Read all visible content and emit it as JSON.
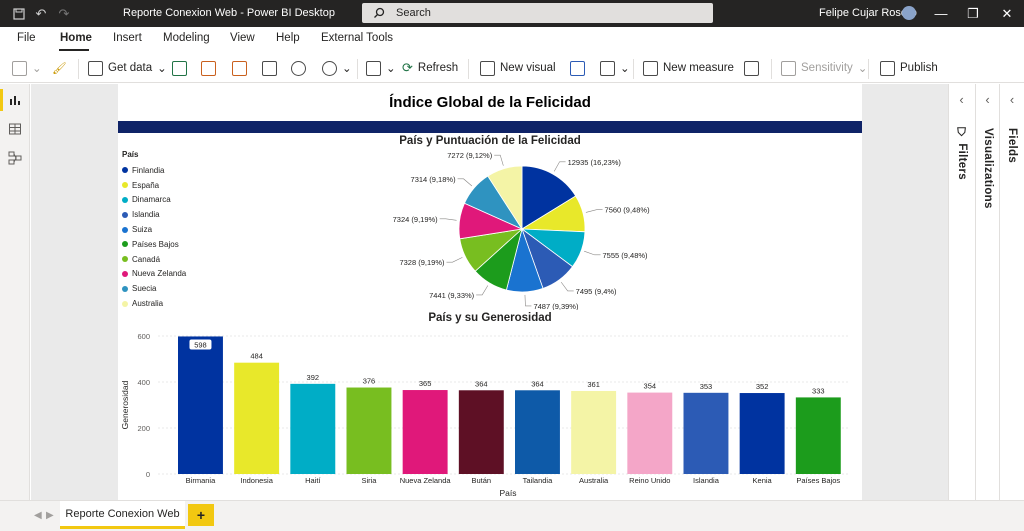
{
  "window": {
    "title": "Reporte Conexion Web - Power BI Desktop",
    "search_placeholder": "Search",
    "user": "Felipe Cujar Rosero"
  },
  "menu": [
    "File",
    "Home",
    "Insert",
    "Modeling",
    "View",
    "Help",
    "External Tools"
  ],
  "ribbon": {
    "get_data": "Get data",
    "refresh": "Refresh",
    "new_visual": "New visual",
    "new_measure": "New measure",
    "sensitivity": "Sensitivity",
    "publish": "Publish"
  },
  "report": {
    "title": "Índice Global de la Felicidad"
  },
  "panes": {
    "filters": "Filters",
    "visualizations": "Visualizations",
    "fields": "Fields"
  },
  "tabs": {
    "page": "Reporte Conexion Web",
    "add": "+"
  },
  "chart_data": [
    {
      "type": "pie",
      "title": "País y Puntuación de la Felicidad",
      "legend_title": "País",
      "legend_position": "left",
      "categories": [
        "Finlandia",
        "España",
        "Dinamarca",
        "Islandia",
        "Suiza",
        "Países Bajos",
        "Canadá",
        "Nueva Zelanda",
        "Suecia",
        "Australia"
      ],
      "values": [
        12935,
        7560,
        7555,
        7495,
        7487,
        7441,
        7328,
        7324,
        7314,
        7272
      ],
      "labels": [
        "12935 (16,23%)",
        "7560 (9,48%)",
        "7555 (9,48%)",
        "7495 (9,4%)",
        "7487 (9,39%)",
        "7441 (9,33%)",
        "7328 (9,19%)",
        "7324 (9,19%)",
        "7314 (9,18%)",
        "7272 (9,12%)"
      ],
      "colors": [
        "#0033a0",
        "#e8e82a",
        "#00adc6",
        "#2c5bb5",
        "#1a73d0",
        "#1c9c1c",
        "#78be20",
        "#e0187a",
        "#2f93c0",
        "#f4f4a6"
      ]
    },
    {
      "type": "bar",
      "title": "País y su Generosidad",
      "xlabel": "País",
      "ylabel": "Generosidad",
      "ylim": [
        0,
        600
      ],
      "yticks": [
        "0",
        "200",
        "400",
        "600"
      ],
      "categories": [
        "Birmania",
        "Indonesia",
        "Haití",
        "Siria",
        "Nueva Zelanda",
        "Bután",
        "Tailandia",
        "Australia",
        "Reino Unido",
        "Islandia",
        "Kenia",
        "Países Bajos"
      ],
      "values": [
        598,
        484,
        392,
        376,
        365,
        364,
        364,
        361,
        354,
        353,
        352,
        333
      ],
      "colors": [
        "#0033a0",
        "#e8e82a",
        "#00adc6",
        "#78be20",
        "#e0187a",
        "#5e1025",
        "#0e5aa8",
        "#f4f4a6",
        "#f4a6c8",
        "#2c5bb5",
        "#0033a0",
        "#1c9c1c"
      ],
      "grid": true
    }
  ]
}
